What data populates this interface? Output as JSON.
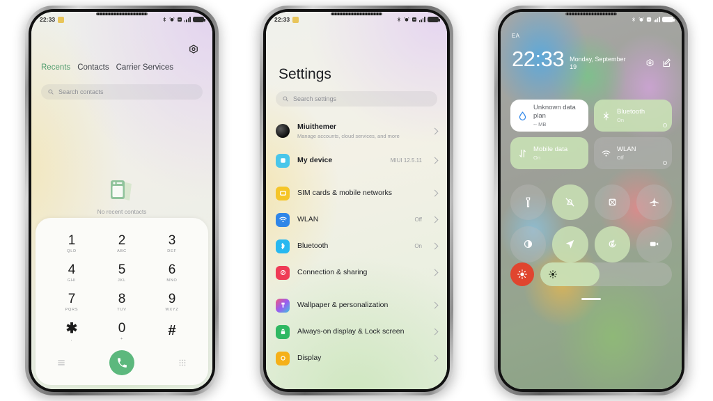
{
  "phones": {
    "dialer": {
      "statusbar": {
        "time": "22:33",
        "icons": [
          "bluetooth-icon",
          "alarm-icon",
          "dnd-icon",
          "signal-icon",
          "battery-icon"
        ]
      },
      "gear_icon": "settings-gear-icon",
      "tabs": [
        {
          "label": "Recents",
          "active": true
        },
        {
          "label": "Contacts",
          "active": false
        },
        {
          "label": "Carrier Services",
          "active": false
        }
      ],
      "search": {
        "placeholder": "Search contacts",
        "icon": "search-icon"
      },
      "empty_state": {
        "caption": "No recent contacts",
        "icon": "contact-cards-icon"
      },
      "keypad": {
        "keys": [
          {
            "num": "1",
            "sub": "QLD"
          },
          {
            "num": "2",
            "sub": "ABC"
          },
          {
            "num": "3",
            "sub": "DEF"
          },
          {
            "num": "4",
            "sub": "GHI"
          },
          {
            "num": "5",
            "sub": "JKL"
          },
          {
            "num": "6",
            "sub": "MNO"
          },
          {
            "num": "7",
            "sub": "PQRS"
          },
          {
            "num": "8",
            "sub": "TUV"
          },
          {
            "num": "9",
            "sub": "WXYZ"
          },
          {
            "num": "✱",
            "sub": ","
          },
          {
            "num": "0",
            "sub": "+"
          },
          {
            "num": "#",
            "sub": ""
          }
        ],
        "actions": {
          "menu_icon": "hamburger-menu-icon",
          "call_icon": "phone-call-icon",
          "keyboard_icon": "dialpad-keyboard-icon"
        }
      }
    },
    "settings": {
      "statusbar": {
        "time": "22:33"
      },
      "title": "Settings",
      "search": {
        "placeholder": "Search settings",
        "icon": "search-icon"
      },
      "items": [
        {
          "label": "Miuithemer",
          "sub": "Manage accounts, cloud services, and more",
          "value": "",
          "icon": "account-avatar",
          "bold": true
        },
        {
          "label": "My device",
          "sub": "",
          "value": "MIUI 12.5.11",
          "icon": "my-device-icon",
          "color": "#49c6ea",
          "bold": true
        },
        {
          "label": "SIM cards & mobile networks",
          "sub": "",
          "value": "",
          "icon": "sim-card-icon",
          "color": "#f5c528"
        },
        {
          "label": "WLAN",
          "sub": "",
          "value": "Off",
          "icon": "wifi-icon",
          "color": "#2f86e8"
        },
        {
          "label": "Bluetooth",
          "sub": "",
          "value": "On",
          "icon": "bluetooth-icon",
          "color": "#28b8f0"
        },
        {
          "label": "Connection & sharing",
          "sub": "",
          "value": "",
          "icon": "connection-sharing-icon",
          "color": "#ef3b55"
        },
        {
          "label": "Wallpaper & personalization",
          "sub": "",
          "value": "",
          "icon": "wallpaper-icon",
          "color": "#c94fb0"
        },
        {
          "label": "Always-on display & Lock screen",
          "sub": "",
          "value": "",
          "icon": "lock-icon",
          "color": "#2fb862"
        },
        {
          "label": "Display",
          "sub": "",
          "value": "",
          "icon": "display-icon",
          "color": "#f5b019"
        }
      ]
    },
    "control_center": {
      "carrier": "EA",
      "clock": "22:33",
      "date": "Monday, September 19",
      "header_icons": [
        {
          "name": "settings-gear-icon"
        },
        {
          "name": "edit-pencil-icon"
        }
      ],
      "tiles": [
        {
          "name": "Unknown data plan",
          "sub": "-- MB",
          "state": "white",
          "icon": "data-usage-drop-icon"
        },
        {
          "name": "Bluetooth",
          "sub": "On",
          "state": "on",
          "icon": "bluetooth-icon"
        },
        {
          "name": "Mobile data",
          "sub": "On",
          "state": "on",
          "icon": "mobile-data-arrows-icon"
        },
        {
          "name": "WLAN",
          "sub": "Off",
          "state": "off",
          "icon": "wifi-icon"
        }
      ],
      "toggles": [
        {
          "name": "flashlight-icon",
          "state": "off"
        },
        {
          "name": "silent-mode-icon",
          "state": "on"
        },
        {
          "name": "screenshot-icon",
          "state": "off"
        },
        {
          "name": "airplane-mode-icon",
          "state": "off"
        },
        {
          "name": "dark-mode-icon",
          "state": "off"
        },
        {
          "name": "location-icon",
          "state": "on"
        },
        {
          "name": "auto-rotate-lock-icon",
          "state": "on"
        },
        {
          "name": "screen-recorder-icon",
          "state": "off"
        }
      ],
      "brightness": {
        "auto_icon": "auto-brightness-icon",
        "auto_color": "#e0452f",
        "slider_icon": "brightness-sun-icon",
        "level_percent": 45
      },
      "home_handle": "home-indicator"
    }
  },
  "theme": {
    "accent_green": "#5cb87d",
    "tab_active": "#4f9c6d",
    "tile_on": "#cae2b5"
  }
}
